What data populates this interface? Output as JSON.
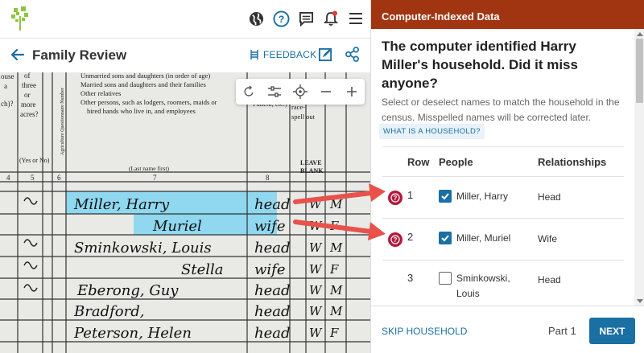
{
  "app": {
    "title": "Family Review"
  },
  "topbar": {
    "icons": [
      "globe-icon",
      "help-icon",
      "messages-icon",
      "notifications-icon",
      "menu-icon"
    ],
    "notification_dot_color": "#e53935"
  },
  "titlebar": {
    "title": "Family Review",
    "feedback_label": "FEEDBACK"
  },
  "census": {
    "headers": {
      "col_a": [
        "ouse",
        "a",
        "ch)?"
      ],
      "col_b": [
        "of",
        "three",
        "or",
        "more",
        "acres?"
      ],
      "col_b_note": "(Yes or No)",
      "col_c": "Agriculture Questionnaire Number",
      "instructions": [
        "Unmarried sons and daughters (in order of age)",
        "Married sons and daughters and their families",
        "Other relatives",
        "Other persons, such as lodgers, roomers, maids or",
        "hired hands who live in, and employees"
      ],
      "last_name_first": "(Last name first)",
      "relationship_header": [
        "Patient, etc.)"
      ],
      "race_header": [
        "race-",
        "spell out"
      ],
      "leave_blank": [
        "LEAVE",
        "BLANK"
      ],
      "col_numbers": [
        "4",
        "5",
        "6",
        "7",
        "8"
      ],
      "yes_no": "(Yes or No)"
    },
    "rows": [
      {
        "name": "Miller, Harry",
        "rel": "head",
        "race": "W",
        "sex": "M"
      },
      {
        "name": "Muriel",
        "rel": "wife",
        "race": "W",
        "sex": "F"
      },
      {
        "name": "Sminkowski, Louis",
        "rel": "head",
        "race": "W",
        "sex": "M"
      },
      {
        "name": "Stella",
        "rel": "wife",
        "race": "W",
        "sex": "F"
      },
      {
        "name": "Eberong, Guy",
        "rel": "head",
        "race": "W",
        "sex": "M"
      },
      {
        "name": "Bradford,",
        "rel": "head",
        "race": "W",
        "sex": "M"
      },
      {
        "name": "Peterson, Helen",
        "rel": "head",
        "race": "W",
        "sex": "F"
      }
    ],
    "highlight_color": "#8fd8ef"
  },
  "panel": {
    "header": "Computer-Indexed Data",
    "question": "The computer identified Harry Miller's household. Did it miss anyone?",
    "instructions": "Select or deselect names to match the household in the census. Misspelled names will be corrected later.",
    "what_link": "WHAT IS A HOUSEHOLD?",
    "columns": {
      "row": "Row",
      "people": "People",
      "relationships": "Relationships"
    },
    "rows": [
      {
        "row": "1",
        "person": "Miller, Harry",
        "relationship": "Head",
        "checked": true,
        "flag": true
      },
      {
        "row": "2",
        "person": "Miller, Muriel",
        "relationship": "Wife",
        "checked": true,
        "flag": true
      },
      {
        "row": "3",
        "person": "Sminkowski, Louis",
        "relationship": "Head",
        "checked": false,
        "flag": false
      }
    ],
    "skip_label": "SKIP HOUSEHOLD",
    "part_label": "Part 1",
    "next_label": "NEXT",
    "colors": {
      "header_bg": "#a23511",
      "accent": "#1a6fa3",
      "flag": "#b3193a",
      "arrow": "#e8524a"
    }
  }
}
